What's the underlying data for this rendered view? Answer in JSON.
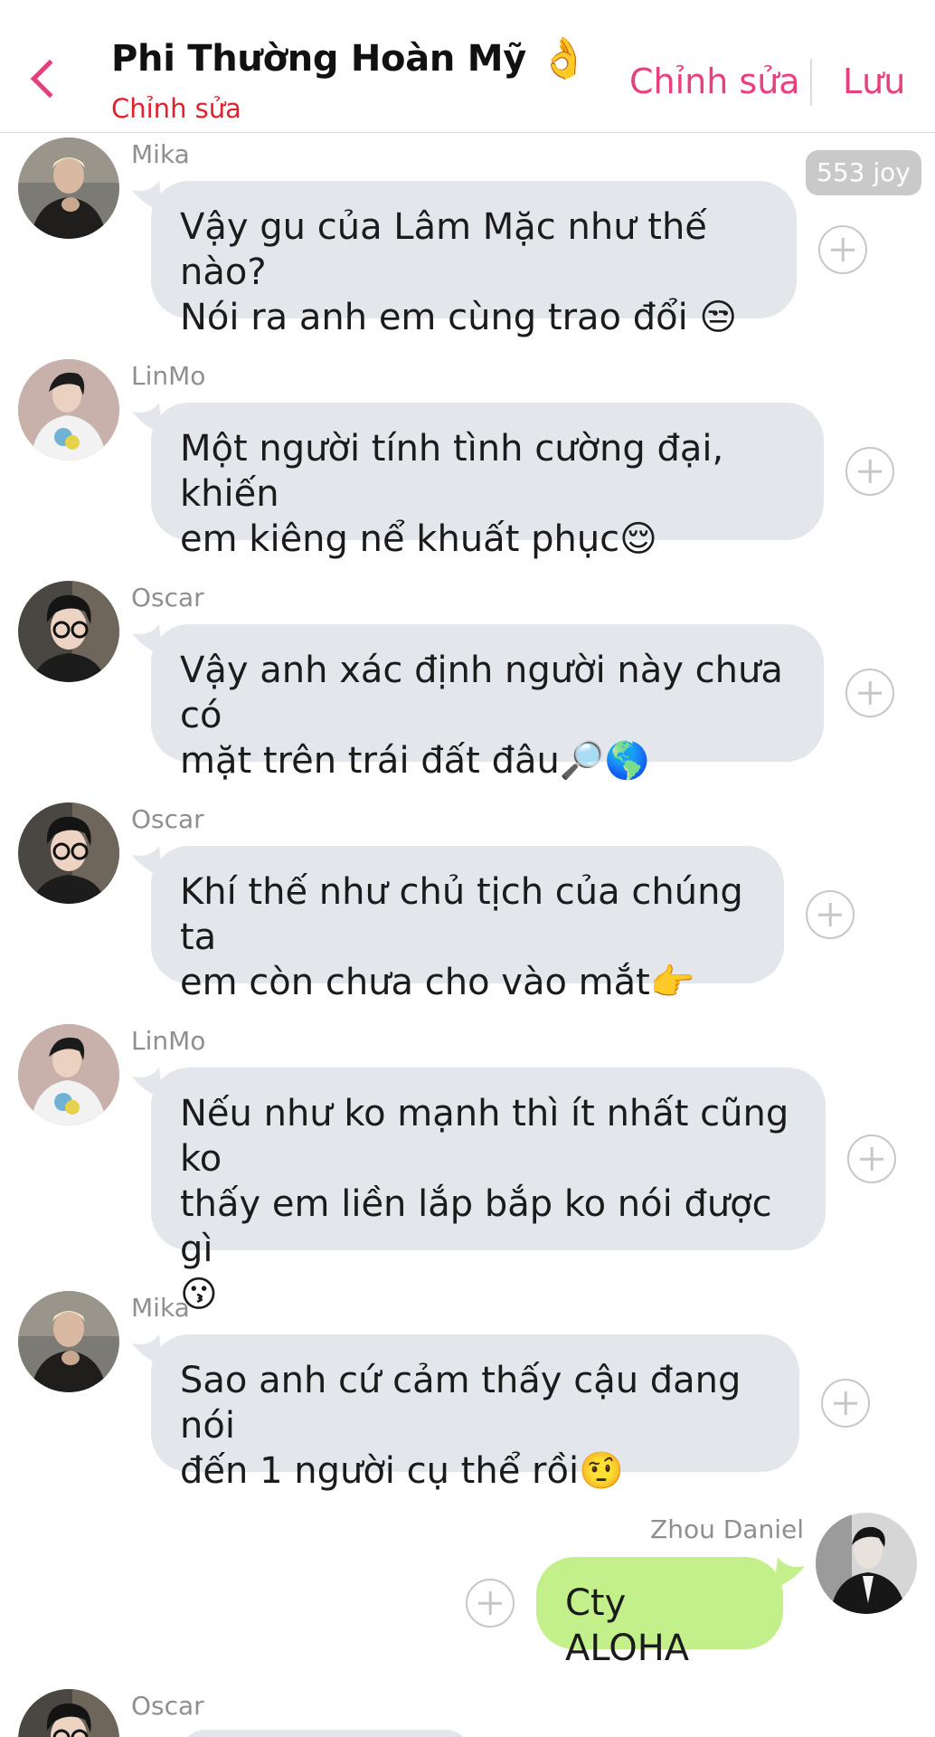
{
  "header": {
    "title": "Phi Thường Hoàn Mỹ",
    "title_emoji": "👌",
    "subtitle": "Chỉnh sửa",
    "edit_label": "Chỉnh sửa",
    "save_label": "Lưu",
    "back_icon": "chevron-left-icon",
    "accent_color": "#e8407e"
  },
  "badge": {
    "text": "553 joy"
  },
  "messages": [
    {
      "sender": "Mika",
      "text_line1": "Vậy gu của Lâm Mặc như thế nào?",
      "text_line2": "Nói ra anh em cùng trao đổi 😒"
    },
    {
      "sender": "LinMo",
      "text_line1": "Một người tính tình cường đại, khiến",
      "text_line2": "em kiêng nể khuất phục😌"
    },
    {
      "sender": "Oscar",
      "text_line1": "Vậy anh xác định người này chưa có",
      "text_line2": "mặt trên trái đất đâu🔎🌎"
    },
    {
      "sender": "Oscar",
      "text_line1": "Khí thế như chủ tịch của chúng ta",
      "text_line2": "em còn chưa cho vào mắt👉"
    },
    {
      "sender": "LinMo",
      "text_line1": "Nếu như ko mạnh thì ít nhất cũng ko",
      "text_line2": "thấy em liền lắp bắp ko nói được gì",
      "text_line3": "😗"
    },
    {
      "sender": "Mika",
      "text_line1": "Sao anh cứ cảm thấy cậu đang nói",
      "text_line2": "đến 1 người cụ thể rồi🤨"
    },
    {
      "sender": "Zhou Daniel",
      "text_line1": "Cty ALOHA"
    },
    {
      "sender": "Oscar"
    }
  ],
  "colors": {
    "incoming_bubble": "#e3e6ea",
    "outgoing_bubble": "#c3f08a",
    "subtitle_red": "#e0212e"
  }
}
